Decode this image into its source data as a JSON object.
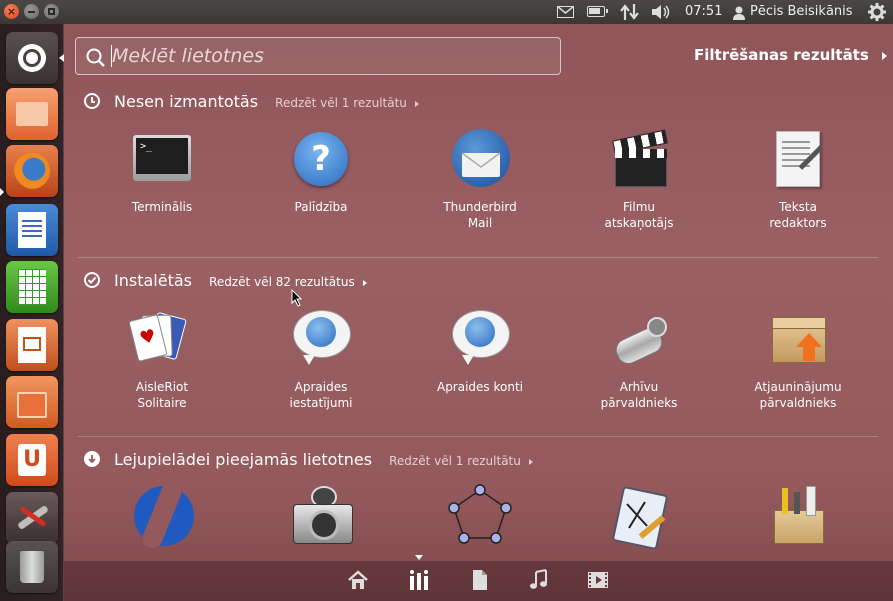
{
  "topbar": {
    "clock": "07:51",
    "user": "Pēcis Beisikānis"
  },
  "search": {
    "placeholder": "Meklēt lietotnes",
    "value": ""
  },
  "filter_label": "Filtrēšanas rezultāts",
  "sections": {
    "recent": {
      "title": "Nesen izmantotās",
      "more": "Redzēt vēl 1 rezultātu",
      "apps": [
        {
          "label": "Terminālis",
          "icon": "terminal-icon"
        },
        {
          "label": "Palīdzība",
          "icon": "help-icon"
        },
        {
          "label": "Thunderbird\nMail",
          "icon": "thunderbird-icon"
        },
        {
          "label": "Filmu\natskaņotājs",
          "icon": "clapperboard-icon"
        },
        {
          "label": "Teksta\nredaktors",
          "icon": "text-editor-icon"
        }
      ]
    },
    "installed": {
      "title": "Instalētās",
      "more": "Redzēt vēl 82 rezultātus",
      "apps": [
        {
          "label": "AisleRiot\nSolitaire",
          "icon": "playing-cards-icon"
        },
        {
          "label": "Apraides\niestatījumi",
          "icon": "broadcast-globe-icon"
        },
        {
          "label": "Apraides konti",
          "icon": "broadcast-globe-icon"
        },
        {
          "label": "Arhīvu\npārvaldnieks",
          "icon": "archive-icon"
        },
        {
          "label": "Atjauninājumu\npārvaldnieks",
          "icon": "update-box-icon"
        }
      ]
    },
    "downloadable": {
      "title": "Lejupielādei pieejamās lietotnes",
      "more": "Redzēt vēl 1 rezultātu",
      "apps": [
        {
          "icon": "blue-swoosh-icon"
        },
        {
          "icon": "robot-camera-icon"
        },
        {
          "icon": "pentagon-nodes-icon"
        },
        {
          "icon": "clipboard-drawing-icon"
        },
        {
          "icon": "toolbox-icon"
        }
      ]
    }
  },
  "colors": {
    "dash_tint": "#94595c",
    "accent_orange": "#dd4814"
  }
}
